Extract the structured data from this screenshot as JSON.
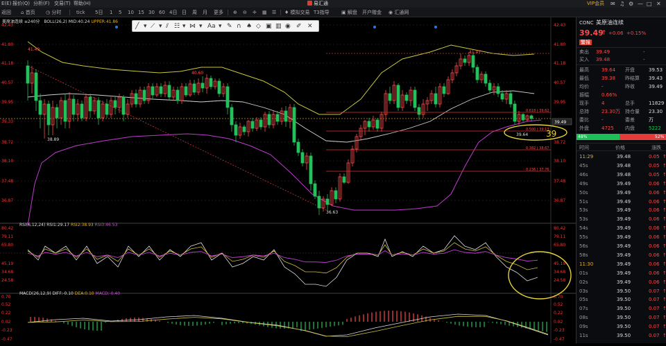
{
  "menubar": {
    "items": [
      "E(E)",
      "报价(Q)",
      "分析(F)",
      "交易(T)",
      "帮助(H)"
    ],
    "app_title": "易汇通",
    "account": "VIP会员",
    "right_icons": [
      "message-icon",
      "bell-icon",
      "settings-icon",
      "minimize-icon",
      "maximize-icon",
      "close-icon"
    ]
  },
  "toolbar": {
    "left": [
      "返回",
      "首页",
      "分时",
      "tick"
    ],
    "periods": [
      "5日",
      "1",
      "5",
      "10",
      "15",
      "30",
      "60",
      "4日",
      "日",
      "周",
      "月",
      "更多"
    ],
    "tools": [
      "模拟交易",
      "T3指导",
      "解盘",
      "开户赠金",
      "汇通网"
    ]
  },
  "main_chart": {
    "symbol_label": "美原油连续 ≡240分",
    "boll_label": "BOLL(26,2)",
    "mid_label": "MID:40.24",
    "upper_label": "UPPER:41.86",
    "price_ticks": [
      "42.43",
      "41.80",
      "41.18",
      "40.57",
      "39.95",
      "39.33",
      "38.72",
      "38.10",
      "37.48",
      "36.87"
    ],
    "high_marks": [
      "41.49",
      "40.60",
      "41.47"
    ],
    "low_marks": [
      "38.89",
      "36.63",
      "39.64"
    ],
    "fib_levels": [
      "0.618 | 39.62",
      "0.500 | 39.13",
      "0.382 | 38.67",
      "0.236 | 37.76"
    ],
    "current_price_tag": "39.49",
    "annotation_text": "39"
  },
  "rsi_panel": {
    "label": "RSI(6,12,24)",
    "rsi1": "RSI1:29.17",
    "rsi2": "RSI2:38.93",
    "rsi3": "RSI3:46.53",
    "ticks": [
      "80.42",
      "79.11",
      "65.80",
      "45.19",
      "34.68",
      "24.58"
    ]
  },
  "macd_panel": {
    "label": "MACD(26,12,9)",
    "diff": "DIFF:-0.10",
    "dea": "DEA:0.10",
    "macd": "MACD:-0.40",
    "ticks": [
      "0.70",
      "0.52",
      "0.22",
      "0.02",
      "-0.23",
      "-0.47"
    ]
  },
  "colors": {
    "up": "#ff4a4a",
    "down": "#23c15b",
    "boll_band": "#c8c83c",
    "boll_mid": "#d0d0d0",
    "boll_low": "#c03ad0",
    "fib": "#e03030",
    "highlight": "#e8d43a"
  },
  "quote": {
    "code": "CONC",
    "name": "美原油连续",
    "price": "39.49",
    "arrow": "↑",
    "change": "+0.06",
    "change_pct": "+0.15%",
    "tag": "警报",
    "sell_label": "卖出",
    "sell_price": "39.49",
    "sell_dash": "-",
    "buy_label": "买入",
    "buy_price": "39.48",
    "buy_dash": "-",
    "stats": [
      {
        "l1": "最高",
        "v1": "39.64",
        "l2": "开盘",
        "v2": "39.53"
      },
      {
        "l1": "最低",
        "v1": "39.38",
        "l2": "昨结算",
        "v2": "39.43"
      },
      {
        "l1": "均价",
        "v1": "-",
        "l2": "昨收",
        "v2": "39.49"
      },
      {
        "l1": "振幅",
        "v1": "0.66%",
        "l2": "",
        "v2": ""
      },
      {
        "l1": "现手",
        "v1": "4",
        "l2": "总手",
        "v2": "11829"
      },
      {
        "l1": "总持",
        "v1": "23.30万",
        "l2": "持仓量",
        "v2": "23.30万"
      },
      {
        "l1": "委比",
        "v1": "-",
        "l2": "委差",
        "v2": "-"
      },
      {
        "l1": "外盘",
        "v1": "4725",
        "l2": "内盘",
        "v2": "5222"
      }
    ],
    "ratio_left": "48%",
    "ratio_right": "52%",
    "ticks_header": [
      "时间",
      "价格",
      "涨跌"
    ],
    "ticks": [
      {
        "t": "11:29",
        "p": "39.48",
        "c": "0.05"
      },
      {
        "t": "45s",
        "p": "39.48",
        "c": "0.05"
      },
      {
        "t": "46s",
        "p": "39.48",
        "c": "0.05"
      },
      {
        "t": "49s",
        "p": "39.49",
        "c": "0.06"
      },
      {
        "t": "50s",
        "p": "39.49",
        "c": "0.06"
      },
      {
        "t": "51s",
        "p": "39.49",
        "c": "0.06"
      },
      {
        "t": "53s",
        "p": "39.49",
        "c": "0.06"
      },
      {
        "t": "53s",
        "p": "39.49",
        "c": "0.06"
      },
      {
        "t": "54s",
        "p": "39.49",
        "c": "0.06"
      },
      {
        "t": "55s",
        "p": "39.49",
        "c": "0.06"
      },
      {
        "t": "56s",
        "p": "39.49",
        "c": "0.06"
      },
      {
        "t": "58s",
        "p": "39.49",
        "c": "0.06"
      },
      {
        "t": "11:30",
        "p": "39.49",
        "c": "0.06"
      },
      {
        "t": "01s",
        "p": "39.49",
        "c": "0.06"
      },
      {
        "t": "02s",
        "p": "39.49",
        "c": "0.06"
      },
      {
        "t": "03s",
        "p": "39.50",
        "c": "0.07"
      },
      {
        "t": "05s",
        "p": "39.50",
        "c": "0.07"
      },
      {
        "t": "07s",
        "p": "39.50",
        "c": "0.07"
      },
      {
        "t": "08s",
        "p": "39.50",
        "c": "0.07"
      },
      {
        "t": "09s",
        "p": "39.50",
        "c": "0.07"
      },
      {
        "t": "11s",
        "p": "39.50",
        "c": "0.07"
      }
    ]
  }
}
